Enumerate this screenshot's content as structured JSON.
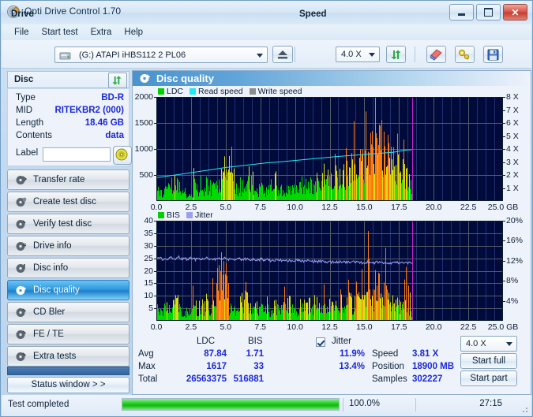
{
  "window": {
    "title": "Opti Drive Control 1.70",
    "icon": "disc-icon",
    "buttons": {
      "minimize": "minimize-icon",
      "maximize": "maximize-icon",
      "close": "close-icon"
    }
  },
  "menu": {
    "items": [
      "File",
      "Start test",
      "Extra",
      "Help"
    ]
  },
  "toolbar": {
    "drive_label": "Drive",
    "drive_value": "(G:)  ATAPI iHBS112  2 PL06",
    "eject_icon": "eject-icon",
    "speed_label": "Speed",
    "speed_value": "4.0 X",
    "refresh_icon": "refresh-icon",
    "erase_icon": "erase-icon",
    "tools_icon": "tools-icon",
    "save_icon": "save-icon"
  },
  "disc": {
    "header": "Disc",
    "refresh_icon": "refresh-icon",
    "rows": [
      {
        "key": "Type",
        "value": "BD-R"
      },
      {
        "key": "MID",
        "value": "RITEKBR2 (000)"
      },
      {
        "key": "Length",
        "value": "18.46 GB"
      },
      {
        "key": "Contents",
        "value": "data"
      }
    ],
    "label_key": "Label",
    "label_value": "",
    "label_placeholder": "",
    "label_icon": "cd-icon"
  },
  "nav": {
    "items": [
      {
        "label": "Transfer rate",
        "icon": "disc-arrow-icon",
        "active": false
      },
      {
        "label": "Create test disc",
        "icon": "disc-write-icon",
        "active": false
      },
      {
        "label": "Verify test disc",
        "icon": "disc-check-icon",
        "active": false
      },
      {
        "label": "Drive info",
        "icon": "drive-info-icon",
        "active": false
      },
      {
        "label": "Disc info",
        "icon": "disc-info-icon",
        "active": false
      },
      {
        "label": "Disc quality",
        "icon": "disc-quality-icon",
        "active": true
      },
      {
        "label": "CD Bler",
        "icon": "disc-bler-icon",
        "active": false
      },
      {
        "label": "FE / TE",
        "icon": "disc-fete-icon",
        "active": false
      },
      {
        "label": "Extra tests",
        "icon": "disc-extra-icon",
        "active": false
      }
    ],
    "status_window_button": "Status window > >"
  },
  "main": {
    "title": "Disc quality",
    "icon": "disc-quality-icon"
  },
  "results": {
    "columns": [
      "LDC",
      "BIS"
    ],
    "jitter_label": "Jitter",
    "jitter_checked": true,
    "rows": [
      {
        "label": "Avg",
        "ldc": "87.84",
        "bis": "1.71",
        "jitter": "11.9%"
      },
      {
        "label": "Max",
        "ldc": "1617",
        "bis": "33",
        "jitter": "13.4%"
      },
      {
        "label": "Total",
        "ldc": "26563375",
        "bis": "516881",
        "jitter": ""
      }
    ],
    "speed_label": "Speed",
    "speed_value": "3.81 X",
    "position_label": "Position",
    "position_value": "18900 MB",
    "samples_label": "Samples",
    "samples_value": "302227",
    "speed_select": "4.0 X",
    "start_full": "Start full",
    "start_part": "Start part"
  },
  "statusbar": {
    "text": "Test completed",
    "progress_percent": "100.0%",
    "progress_value": 100,
    "elapsed": "27:15"
  },
  "chart_data": [
    {
      "type": "area",
      "id": "ldc-chart",
      "title": "",
      "xlabel": "GB",
      "ylabel": "",
      "xlim": [
        0,
        25
      ],
      "ylim": [
        0,
        2000
      ],
      "y2lim": [
        0,
        8
      ],
      "grid": true,
      "legend_position": "top-left",
      "legend": [
        {
          "name": "LDC",
          "color": "#00d000"
        },
        {
          "name": "Read speed",
          "color": "#20e8f8"
        },
        {
          "name": "Write speed",
          "color": "#8c8c8c"
        }
      ],
      "xticks": [
        "0.0",
        "2.5",
        "5.0",
        "7.5",
        "10.0",
        "12.5",
        "15.0",
        "17.5",
        "20.0",
        "22.5",
        "25.0 GB"
      ],
      "yticks": [
        "2000",
        "1500",
        "1000",
        "500"
      ],
      "y2ticks": [
        "8 X",
        "7 X",
        "6 X",
        "5 X",
        "4 X",
        "3 X",
        "2 X",
        "1 X"
      ],
      "data_end_gb": 18.46,
      "marker_gb": 18.46,
      "marker_color": "#c824c8",
      "series": [
        {
          "name": "LDC",
          "color": "#00d000",
          "x": [
            0.0,
            0.1,
            0.2,
            0.3,
            0.4,
            0.5,
            0.6,
            0.7,
            0.8,
            0.9,
            1.0,
            1.1,
            1.2,
            1.3,
            1.4,
            1.5,
            1.6,
            1.7,
            1.8,
            1.9,
            2.0,
            2.1,
            2.2,
            2.3,
            2.4,
            2.5,
            2.6,
            2.7,
            2.8,
            2.9,
            3.0,
            3.1,
            3.2,
            3.3,
            3.4,
            3.5,
            3.6,
            3.7,
            3.8,
            3.9,
            4.0,
            4.1,
            4.2,
            4.3,
            4.4,
            4.5,
            4.6,
            4.7,
            4.8,
            4.9,
            5.0,
            5.1,
            5.2,
            5.3,
            5.4,
            5.5,
            5.6,
            5.7,
            5.8,
            5.9,
            6.0,
            6.1,
            6.2,
            6.3,
            6.4,
            6.5,
            6.6,
            6.7,
            6.8,
            6.9,
            7.0,
            7.1,
            7.2,
            7.3,
            7.4,
            7.5,
            7.6,
            7.7,
            7.8,
            7.9,
            8.0,
            8.1,
            8.2,
            8.3,
            8.4,
            8.5,
            8.6,
            8.7,
            8.8,
            8.9,
            9.0,
            9.1,
            9.2,
            9.3,
            9.4,
            9.5,
            9.6,
            9.7,
            9.8,
            9.9,
            10.0,
            10.2,
            10.4,
            10.6,
            10.8,
            11.0,
            11.2,
            11.4,
            11.6,
            11.8,
            12.0,
            12.2,
            12.4,
            12.6,
            12.8,
            13.0,
            13.2,
            13.4,
            13.6,
            13.8,
            14.0,
            14.2,
            14.4,
            14.6,
            14.8,
            15.0,
            15.2,
            15.4,
            15.6,
            15.8,
            16.0,
            16.2,
            16.4,
            16.6,
            16.8,
            17.0,
            17.2,
            17.4,
            17.6,
            17.8,
            18.0,
            18.2,
            18.4
          ],
          "values": [
            150,
            210,
            170,
            260,
            190,
            240,
            200,
            330,
            250,
            300,
            280,
            420,
            360,
            480,
            300,
            520,
            340,
            290,
            230,
            180,
            150,
            120,
            100,
            90,
            140,
            110,
            130,
            260,
            180,
            300,
            200,
            250,
            190,
            230,
            170,
            220,
            420,
            260,
            300,
            210,
            480,
            330,
            270,
            350,
            240,
            460,
            380,
            560,
            700,
            880,
            1010,
            820,
            950,
            1060,
            880,
            430,
            300,
            250,
            360,
            230,
            290,
            200,
            330,
            250,
            420,
            300,
            560,
            740,
            520,
            430,
            300,
            250,
            330,
            200,
            280,
            230,
            300,
            190,
            250,
            220,
            330,
            260,
            420,
            300,
            480,
            350,
            560,
            300,
            250,
            270,
            330,
            200,
            280,
            250,
            300,
            220,
            350,
            260,
            400,
            300,
            350,
            280,
            420,
            330,
            380,
            300,
            440,
            360,
            480,
            400,
            520,
            440,
            560,
            480,
            600,
            520,
            640,
            560,
            700,
            620,
            860,
            720,
            900,
            800,
            980,
            900,
            1120,
            1010,
            1420,
            1260,
            1180,
            1300,
            1520,
            1380,
            1260,
            1100,
            980,
            900,
            760,
            660,
            540,
            430,
            310
          ]
        },
        {
          "name": "Read speed",
          "color": "#20e8f8",
          "axis": "y2",
          "x": [
            0.0,
            1.0,
            2.0,
            3.0,
            4.0,
            5.0,
            6.0,
            7.0,
            8.0,
            9.0,
            10.0,
            11.0,
            12.0,
            13.0,
            14.0,
            15.0,
            16.0,
            17.0,
            18.0,
            18.46
          ],
          "values": [
            1.8,
            1.95,
            2.1,
            2.26,
            2.42,
            2.58,
            2.7,
            2.82,
            2.94,
            3.02,
            3.12,
            3.22,
            3.32,
            3.42,
            3.5,
            3.58,
            3.66,
            3.74,
            3.92,
            3.95
          ]
        }
      ]
    },
    {
      "type": "area",
      "id": "bis-jitter-chart",
      "title": "",
      "xlabel": "GB",
      "ylabel": "",
      "xlim": [
        0,
        25
      ],
      "ylim": [
        0,
        40
      ],
      "y2lim": [
        0,
        20
      ],
      "grid": true,
      "legend_position": "top-left",
      "legend": [
        {
          "name": "BIS",
          "color": "#00d000"
        },
        {
          "name": "Jitter",
          "color": "#9aa0f0"
        }
      ],
      "xticks": [
        "0.0",
        "2.5",
        "5.0",
        "7.5",
        "10.0",
        "12.5",
        "15.0",
        "17.5",
        "20.0",
        "22.5",
        "25.0 GB"
      ],
      "yticks": [
        "40",
        "35",
        "30",
        "25",
        "20",
        "15",
        "10",
        "5"
      ],
      "y2ticks": [
        "20%",
        "16%",
        "12%",
        "8%",
        "4%"
      ],
      "data_end_gb": 18.46,
      "marker_gb": 18.46,
      "marker_color": "#c824c8",
      "series": [
        {
          "name": "BIS",
          "color": "#00d000",
          "x": [
            0.0,
            0.1,
            0.2,
            0.3,
            0.4,
            0.5,
            0.6,
            0.7,
            0.8,
            0.9,
            1.0,
            1.1,
            1.2,
            1.3,
            1.4,
            1.5,
            1.6,
            1.7,
            1.8,
            1.9,
            2.0,
            2.1,
            2.2,
            2.3,
            2.4,
            2.5,
            2.6,
            2.7,
            2.8,
            2.9,
            3.0,
            3.1,
            3.2,
            3.3,
            3.4,
            3.5,
            3.6,
            3.7,
            3.8,
            3.9,
            4.0,
            4.1,
            4.2,
            4.3,
            4.4,
            4.5,
            4.6,
            4.7,
            4.8,
            4.9,
            5.0,
            5.1,
            5.2,
            5.3,
            5.4,
            5.5,
            5.6,
            5.7,
            5.8,
            5.9,
            6.0,
            6.2,
            6.4,
            6.6,
            6.8,
            7.0,
            7.2,
            7.4,
            7.6,
            7.8,
            8.0,
            8.2,
            8.4,
            8.6,
            8.8,
            9.0,
            9.2,
            9.4,
            9.6,
            9.8,
            10.0,
            10.2,
            10.4,
            10.6,
            10.8,
            11.0,
            11.2,
            11.4,
            11.6,
            11.8,
            12.0,
            12.2,
            12.4,
            12.6,
            12.8,
            13.0,
            13.2,
            13.4,
            13.6,
            13.8,
            14.0,
            14.2,
            14.4,
            14.6,
            14.8,
            15.0,
            15.2,
            15.4,
            15.6,
            15.8,
            16.0,
            16.2,
            16.4,
            16.6,
            16.8,
            17.0,
            17.2,
            17.4,
            17.6,
            17.8,
            18.0,
            18.2,
            18.4
          ],
          "values": [
            3,
            5,
            4,
            6,
            4,
            7,
            5,
            8,
            6,
            7,
            5,
            9,
            7,
            11,
            8,
            12,
            6,
            5,
            4,
            3,
            4,
            3,
            5,
            4,
            6,
            4,
            7,
            5,
            8,
            6,
            5,
            7,
            5,
            9,
            6,
            8,
            14,
            7,
            6,
            5,
            9,
            7,
            6,
            8,
            12,
            18,
            21,
            23,
            19,
            22,
            20,
            10,
            6,
            5,
            7,
            5,
            6,
            4,
            7,
            5,
            9,
            7,
            14,
            9,
            7,
            6,
            8,
            5,
            7,
            5,
            6,
            4,
            8,
            6,
            9,
            5,
            7,
            6,
            11,
            7,
            6,
            5,
            9,
            7,
            6,
            8,
            6,
            10,
            7,
            6,
            9,
            7,
            11,
            8,
            7,
            9,
            6,
            12,
            8,
            14,
            9,
            7,
            13,
            9,
            11,
            8,
            16,
            10,
            13,
            9,
            17,
            11,
            14,
            16,
            12,
            10,
            8,
            9,
            7,
            6,
            9,
            7,
            5
          ]
        },
        {
          "name": "Jitter",
          "color": "#9aa0f0",
          "axis": "y2",
          "x": [
            0.0,
            0.2,
            0.4,
            0.6,
            0.8,
            1.0,
            1.2,
            1.4,
            1.6,
            1.8,
            2.0,
            2.2,
            2.4,
            2.6,
            2.8,
            3.0,
            3.2,
            3.4,
            3.6,
            3.8,
            4.0,
            4.2,
            4.4,
            4.6,
            4.8,
            5.0,
            5.2,
            5.4,
            5.6,
            5.8,
            6.0,
            6.2,
            6.4,
            6.6,
            6.8,
            7.0,
            7.2,
            7.4,
            7.6,
            7.8,
            8.0,
            8.2,
            8.4,
            8.6,
            8.8,
            9.0,
            9.2,
            9.4,
            9.6,
            9.8,
            10.0,
            10.4,
            10.8,
            11.2,
            11.6,
            12.0,
            12.4,
            12.8,
            13.2,
            13.6,
            14.0,
            14.4,
            14.8,
            15.2,
            15.6,
            16.0,
            16.4,
            16.8,
            17.2,
            17.6,
            18.0,
            18.4
          ],
          "values": [
            12.4,
            12.6,
            12.3,
            12.5,
            12.4,
            12.6,
            12.3,
            12.5,
            12.7,
            12.4,
            12.5,
            12.3,
            12.6,
            12.4,
            12.2,
            12.5,
            12.3,
            12.4,
            12.6,
            12.3,
            12.5,
            12.2,
            12.4,
            12.3,
            12.5,
            12.4,
            12.3,
            12.2,
            12.4,
            12.3,
            12.4,
            12.2,
            12.3,
            12.4,
            12.2,
            12.3,
            12.1,
            12.2,
            12.3,
            12.1,
            12.2,
            12.0,
            12.2,
            12.1,
            12.3,
            12.1,
            12.2,
            12.0,
            12.1,
            12.0,
            12.1,
            11.9,
            12.0,
            11.9,
            11.8,
            11.9,
            11.8,
            11.7,
            11.8,
            11.7,
            11.8,
            11.7,
            11.6,
            11.7,
            11.6,
            11.7,
            11.6,
            11.5,
            11.6,
            11.5,
            11.6,
            11.5
          ]
        }
      ]
    }
  ]
}
